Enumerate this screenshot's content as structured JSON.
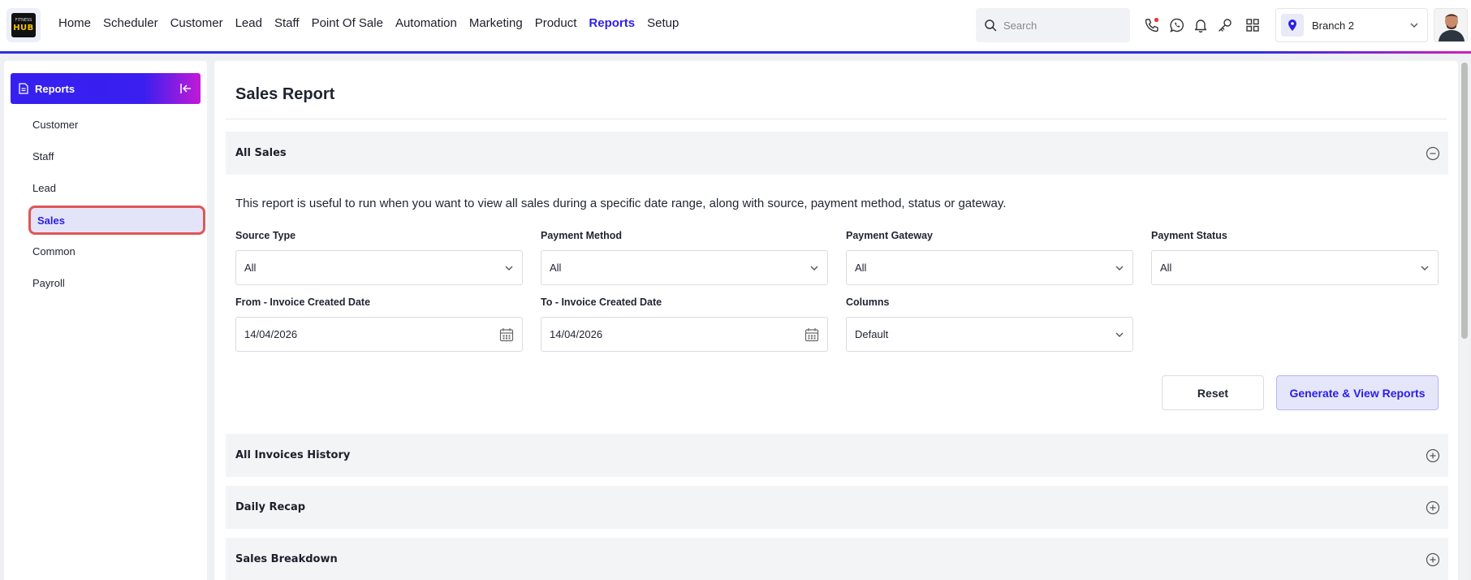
{
  "app": {
    "logo_top": "FITNESS",
    "logo_text": "HUB"
  },
  "nav": {
    "items": [
      {
        "label": "Home"
      },
      {
        "label": "Scheduler"
      },
      {
        "label": "Customer"
      },
      {
        "label": "Lead"
      },
      {
        "label": "Staff"
      },
      {
        "label": "Point Of Sale"
      },
      {
        "label": "Automation"
      },
      {
        "label": "Marketing"
      },
      {
        "label": "Product"
      },
      {
        "label": "Reports",
        "active": true
      },
      {
        "label": "Setup"
      }
    ]
  },
  "search": {
    "placeholder": "Search"
  },
  "toolbar_icons": [
    "phone-icon",
    "whatsapp-icon",
    "bell-icon",
    "key-icon",
    "apps-grid-icon"
  ],
  "branch": {
    "label": "Branch 2"
  },
  "sidebar": {
    "header": "Reports",
    "items": [
      {
        "label": "Customer"
      },
      {
        "label": "Staff"
      },
      {
        "label": "Lead"
      },
      {
        "label": "Sales",
        "active": true
      },
      {
        "label": "Common"
      },
      {
        "label": "Payroll"
      }
    ]
  },
  "main": {
    "title": "Sales Report",
    "all_sales": {
      "title": "All Sales",
      "expanded": true,
      "description": "This report is useful to run when you want to view all sales during a specific date range, along with source, payment method, status or gateway.",
      "filters": {
        "source_type": {
          "label": "Source Type",
          "value": "All"
        },
        "payment_method": {
          "label": "Payment Method",
          "value": "All"
        },
        "payment_gateway": {
          "label": "Payment Gateway",
          "value": "All"
        },
        "payment_status": {
          "label": "Payment Status",
          "value": "All"
        },
        "from_date": {
          "label": "From - Invoice Created Date",
          "value": "14/04/2026"
        },
        "to_date": {
          "label": "To - Invoice Created Date",
          "value": "14/04/2026"
        },
        "columns": {
          "label": "Columns",
          "value": "Default"
        }
      },
      "reset_label": "Reset",
      "generate_label": "Generate & View Reports"
    },
    "sections": [
      {
        "title": "All Invoices History"
      },
      {
        "title": "Daily Recap"
      },
      {
        "title": "Sales Breakdown"
      }
    ]
  },
  "colors": {
    "accent": "#2f22e8",
    "active_outline": "#e05656"
  }
}
